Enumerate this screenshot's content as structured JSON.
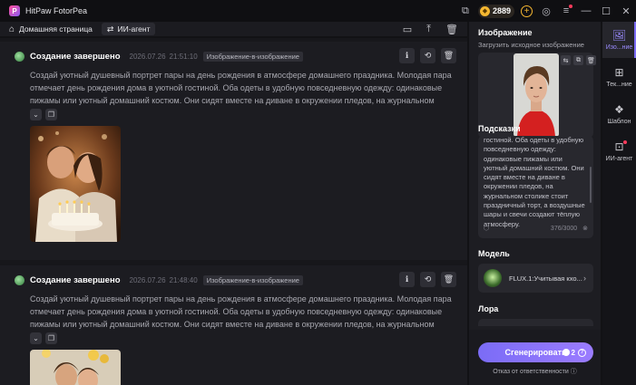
{
  "app": {
    "title": "HitPaw FotorPea",
    "credits": "2889"
  },
  "toolbar": {
    "home_label": "Домашняя страница",
    "agent_tab_label": "ИИ-агент"
  },
  "feed": {
    "items": [
      {
        "title": "Создание завершено",
        "date": "2026.07.26",
        "time": "21:51:10",
        "badge": "Изображение-в-изображение",
        "text": "Создай уютный душевный портрет пары на день рождения в атмосфере домашнего праздника. Молодая пара отмечает день рождения дома в уютной гостиной. Оба одеты в удобную повседневную одежду: одинаковые пижамы или уютный домашний костюм. Они сидят вместе на диване в окружении пледов, на журнальном столи..."
      },
      {
        "title": "Создание завершено",
        "date": "2026.07.26",
        "time": "21:48:40",
        "badge": "Изображение-в-изображение",
        "text": "Создай уютный душевный портрет пары на день рождения в атмосфере домашнего праздника. Молодая пара отмечает день рождения дома в уютной гостиной. Оба одеты в удобную повседневную одежду: одинаковые пижамы или уютный домашний костюм. Они сидят вместе на диване в окружении пледов, на журнальном столи..."
      }
    ]
  },
  "panel": {
    "image_title": "Изображение",
    "image_sub": "Загрузить исходное изображение",
    "prompt_title": "Подсказки",
    "prompt_text": "гостиной. Оба одеты в удобную повседневную одежду: одинаковые пижамы или уютный домашний костюм. Они сидят вместе на диване в окружении пледов, на журнальном столике стоит праздничный торт, а воздушные шары и свечи создают тёплую атмосферу.",
    "prompt_count": "376/3000",
    "model_title": "Модель",
    "model_name": "FLUX.1:Учитывая кхо...",
    "lora_title": "Лора",
    "generate_label": "Сгенерировать",
    "generate_cost": "2",
    "disclaimer": "Отказ от ответственности"
  },
  "nav": {
    "items": [
      {
        "label": "Изо...ние",
        "icon": "image-icon"
      },
      {
        "label": "Тек...ние",
        "icon": "text-edit-icon"
      },
      {
        "label": "Шаблон",
        "icon": "template-icon"
      },
      {
        "label": "ИИ-агент",
        "icon": "ai-agent-icon"
      }
    ]
  },
  "colors": {
    "accent": "#7b6cf6",
    "background": "#121215",
    "panel": "#1d1d22",
    "coin": "#f5b731"
  }
}
